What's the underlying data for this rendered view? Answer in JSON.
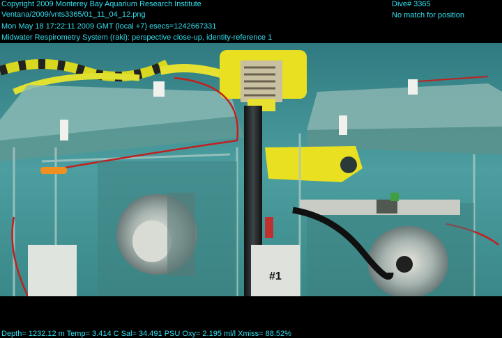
{
  "overlay": {
    "copyright": "Copyright 2009 Monterey Bay Aquarium Research Institute",
    "file_path": "Ventana/2009/vnts3365/01_11_04_12.png",
    "timestamp": "Mon May 18 17:22:11 2009 GMT (local +7)  esecs=1242667331",
    "description": "Midwater Respirometry System (raki): perspective close-up, identity-reference 1",
    "dive": "Dive# 3365",
    "position_status": "No match for position",
    "telemetry": "Depth= 1232.12 m  Temp= 3.414 C  Sal= 34.491 PSU  Oxy= 2.195 ml/l  Xmiss= 88.52%"
  },
  "scene": {
    "chamber_label": "#1"
  },
  "colors": {
    "overlay_text": "#33e0f0",
    "water": "#4a9a9c",
    "yellow_part": "#e8e020",
    "red_line": "#c02020"
  }
}
